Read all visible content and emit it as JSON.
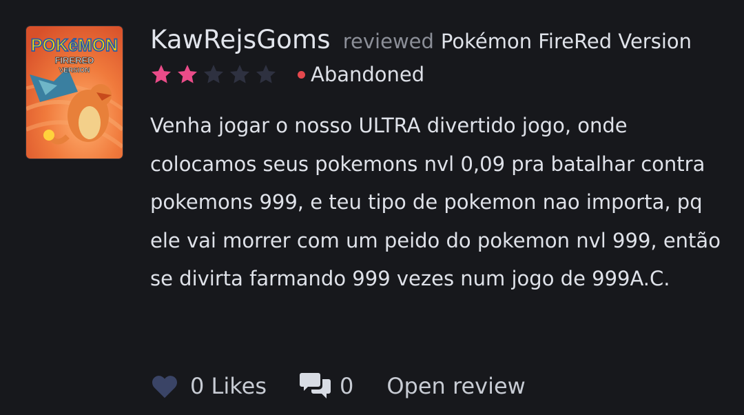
{
  "review": {
    "username": "KawRejsGoms",
    "reviewed_label": "reviewed",
    "game_title": "Pokémon FireRed Version",
    "rating": {
      "filled": 2,
      "total": 5
    },
    "status": "Abandoned",
    "text": "Venha jogar o nosso ULTRA divertido jogo, onde colocamos seus pokemons nvl 0,09 pra batalhar contra pokemons 999, e teu tipo de pokemon nao importa, pq ele vai morrer com um peido do pokemon nvl 999, então se divirta farmando 999 vezes num jogo de 999A.C."
  },
  "cover_art": {
    "logo": "POKéMON",
    "subtitle_1": "FIRERED",
    "subtitle_2": "VERSION"
  },
  "footer": {
    "likes_label": "0 Likes",
    "comments_count": "0",
    "open_review_label": "Open review"
  },
  "colors": {
    "background": "#17181c",
    "star_filled": "#ea4c89",
    "star_empty": "#2e3140",
    "status_dot": "#e5484d"
  },
  "icons": {
    "like": "heart-icon",
    "comments": "comments-icon",
    "star": "star-icon"
  }
}
